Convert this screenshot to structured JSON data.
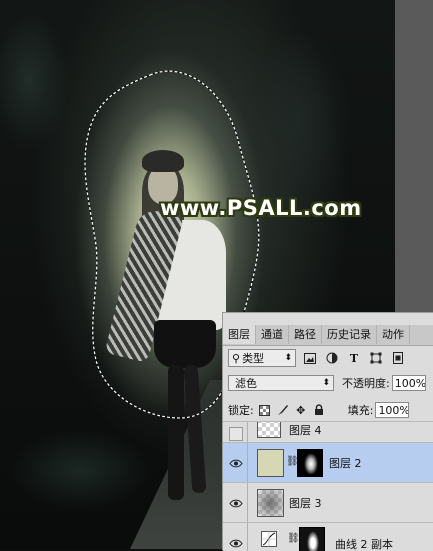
{
  "watermark": "www.PSALL.com",
  "layers_panel": {
    "tabs": [
      {
        "label": "图层",
        "active": true
      },
      {
        "label": "通道",
        "active": false
      },
      {
        "label": "路径",
        "active": false
      },
      {
        "label": "历史记录",
        "active": false
      },
      {
        "label": "动作",
        "active": false
      }
    ],
    "filter": {
      "icon": "search-icon",
      "label": "类型"
    },
    "filter_icons": [
      "image-filter-icon",
      "adjustment-filter-icon",
      "type-filter-icon",
      "shape-filter-icon",
      "smart-object-filter-icon"
    ],
    "blend_mode": "滤色",
    "opacity_label": "不透明度:",
    "opacity_value": "100%",
    "lock_label": "锁定:",
    "lock_icons": [
      "lock-transparent-icon",
      "lock-paint-icon",
      "lock-move-icon",
      "lock-all-icon"
    ],
    "fill_label": "填充:",
    "fill_value": "100%",
    "layers": [
      {
        "name": "图层 4",
        "visible": false,
        "selected": false,
        "thumb": "transparent"
      },
      {
        "name": "图层 2",
        "visible": true,
        "selected": true,
        "thumb": "color-fill",
        "has_mask": true,
        "fill_color": "#d6d8b5"
      },
      {
        "name": "图层 3",
        "visible": true,
        "selected": false,
        "thumb": "transparent-gradient"
      },
      {
        "name": "曲线 2 副本",
        "visible": true,
        "selected": false,
        "thumb": "curves-adjustment",
        "has_mask": true
      }
    ]
  },
  "colors": {
    "selected_layer": "#b6cdf0",
    "panel_bg": "#dcdcdc",
    "watermark_outline": "#2e3a10"
  }
}
